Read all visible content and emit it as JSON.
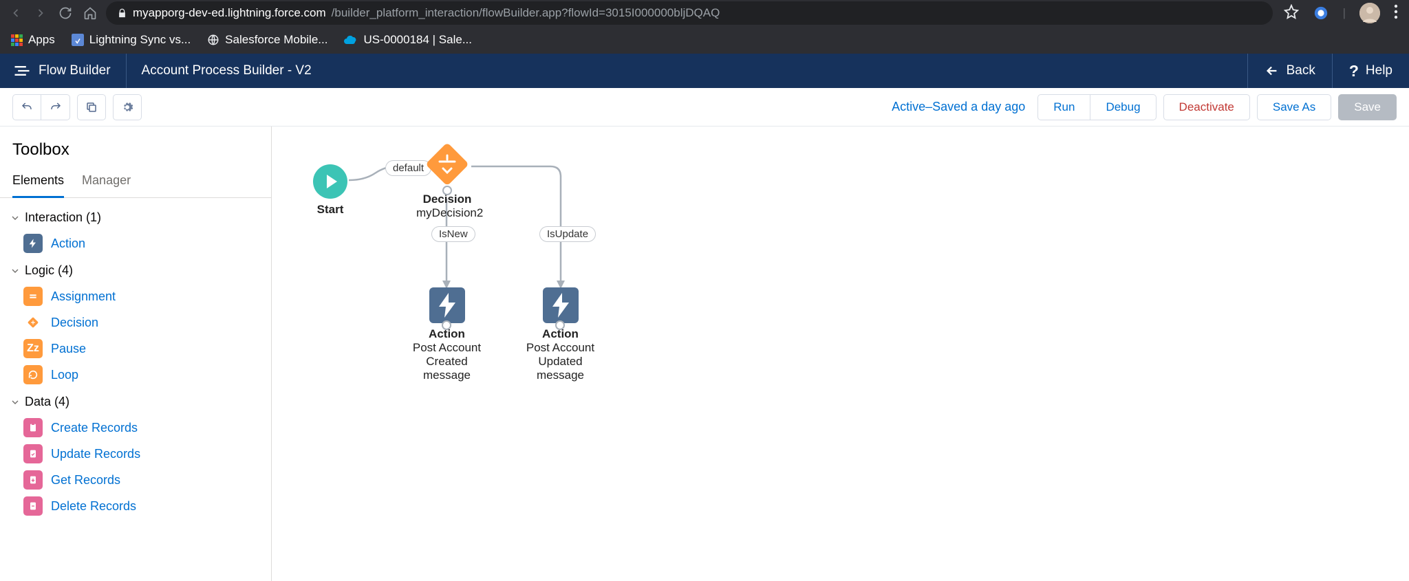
{
  "browser": {
    "url_domain": "myapporg-dev-ed.lightning.force.com",
    "url_path": "/builder_platform_interaction/flowBuilder.app?flowId=3015I000000bljDQAQ",
    "bookmarks": {
      "apps": "Apps",
      "sync": "Lightning Sync vs...",
      "mobile": "Salesforce Mobile...",
      "case": "US-0000184 | Sale..."
    }
  },
  "header": {
    "app_title": "Flow Builder",
    "flow_title": "Account Process Builder - V2",
    "back": "Back",
    "help": "Help"
  },
  "toolbar": {
    "status": "Active–Saved a day ago",
    "run": "Run",
    "debug": "Debug",
    "deactivate": "Deactivate",
    "save_as": "Save As",
    "save": "Save"
  },
  "sidebar": {
    "title": "Toolbox",
    "tabs": {
      "elements": "Elements",
      "manager": "Manager"
    },
    "groups": {
      "interaction": {
        "label": "Interaction (1)",
        "items": {
          "action": "Action"
        }
      },
      "logic": {
        "label": "Logic (4)",
        "items": {
          "assignment": "Assignment",
          "decision": "Decision",
          "pause": "Pause",
          "loop": "Loop"
        }
      },
      "data": {
        "label": "Data (4)",
        "items": {
          "create": "Create Records",
          "update": "Update Records",
          "get": "Get Records",
          "delete_": "Delete Records"
        }
      }
    }
  },
  "canvas": {
    "start": "Start",
    "decision": {
      "type": "Decision",
      "name": "myDecision2"
    },
    "default": "default",
    "isnew": "IsNew",
    "isupdate": "IsUpdate",
    "act1": {
      "type": "Action",
      "l1": "Post Account",
      "l2": "Created message"
    },
    "act2": {
      "type": "Action",
      "l1": "Post Account",
      "l2": "Updated message"
    }
  }
}
